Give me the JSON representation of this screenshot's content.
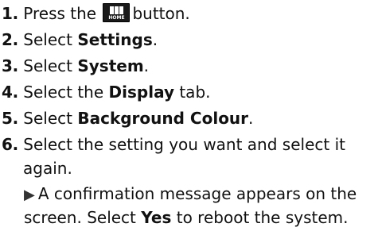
{
  "steps": [
    {
      "number": "1.",
      "before": "Press the",
      "icon": "home-button-icon",
      "icon_label": "HOME",
      "after": "button."
    },
    {
      "number": "2.",
      "before": "Select",
      "bold": "Settings",
      "after": "."
    },
    {
      "number": "3.",
      "before": "Select",
      "bold": "System",
      "after": "."
    },
    {
      "number": "4.",
      "before": "Select the",
      "bold": "Display",
      "after": "tab."
    },
    {
      "number": "5.",
      "before": "Select",
      "bold": "Background Colour",
      "after": "."
    },
    {
      "number": "6.",
      "line1": "Select the setting you want and select it",
      "line2": "again."
    }
  ],
  "result": {
    "icon": "arrow-right-icon",
    "line1": "A confirmation message appears on the",
    "line2_before": "screen. Select",
    "line2_bold": "Yes",
    "line2_after": "to reboot the system."
  }
}
